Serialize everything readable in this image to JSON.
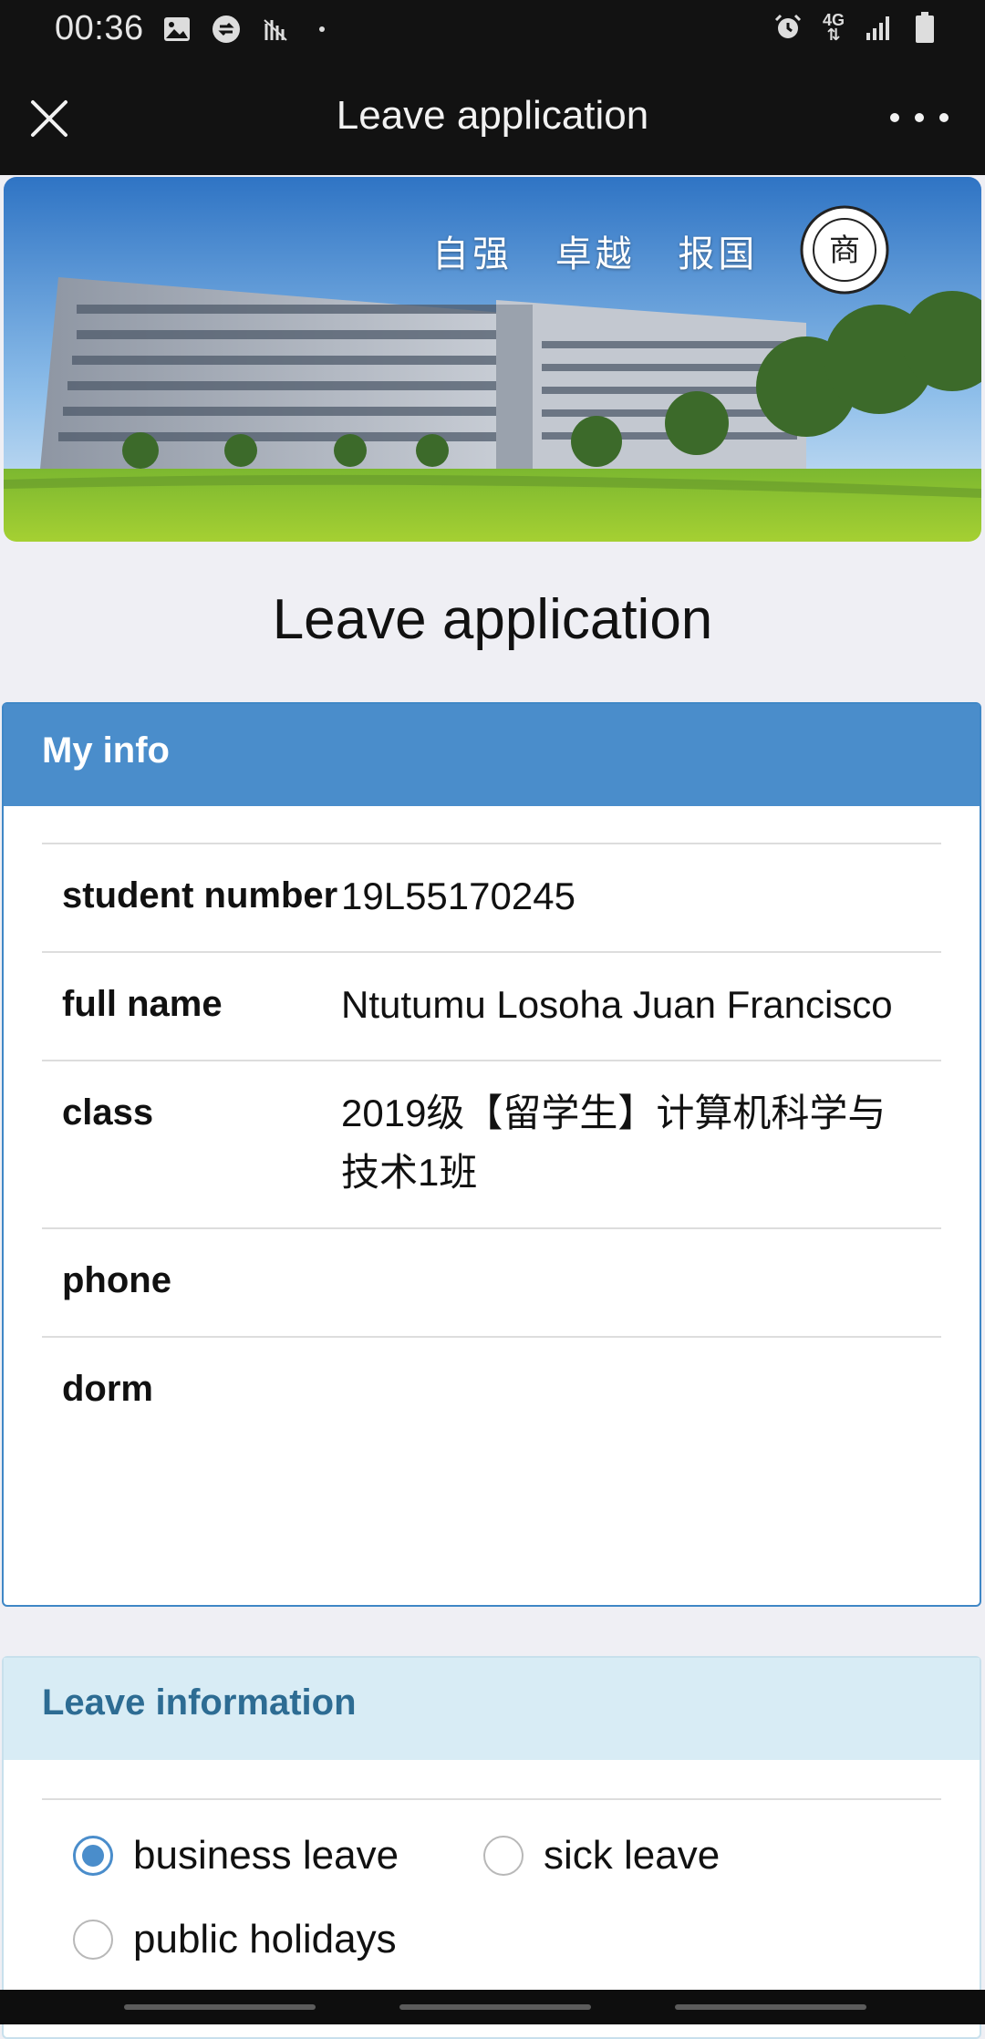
{
  "status_bar": {
    "time": "00:36",
    "left_icons": [
      "image-icon",
      "sync-icon",
      "signal-wave-icon"
    ],
    "right_icons": [
      "alarm-icon",
      "4g-icon",
      "cell-signal-icon",
      "battery-icon"
    ],
    "network_label": "4G"
  },
  "app_bar": {
    "title": "Leave application",
    "close_icon": "close-icon",
    "more_icon": "more-dots-icon"
  },
  "banner": {
    "motto": "自强 卓越 报国"
  },
  "page": {
    "title": "Leave application"
  },
  "my_info": {
    "heading": "My info",
    "rows": [
      {
        "label": "student number",
        "value": "19L55170245"
      },
      {
        "label": "full name",
        "value": "Ntutumu Losoha Juan Francisco"
      },
      {
        "label": "class",
        "value": "2019级【留学生】计算机科学与技术1班"
      },
      {
        "label": "phone",
        "value": ""
      },
      {
        "label": "dorm",
        "value": ""
      }
    ]
  },
  "leave_info": {
    "heading": "Leave information",
    "options": [
      {
        "label": "business leave",
        "checked": true
      },
      {
        "label": "sick leave",
        "checked": false
      },
      {
        "label": "public holidays",
        "checked": false
      }
    ]
  },
  "colors": {
    "accent": "#4a8dcb",
    "header_bg": "#121212",
    "leave_head_bg": "#d8ecf5",
    "leave_head_text": "#2d6c93"
  }
}
